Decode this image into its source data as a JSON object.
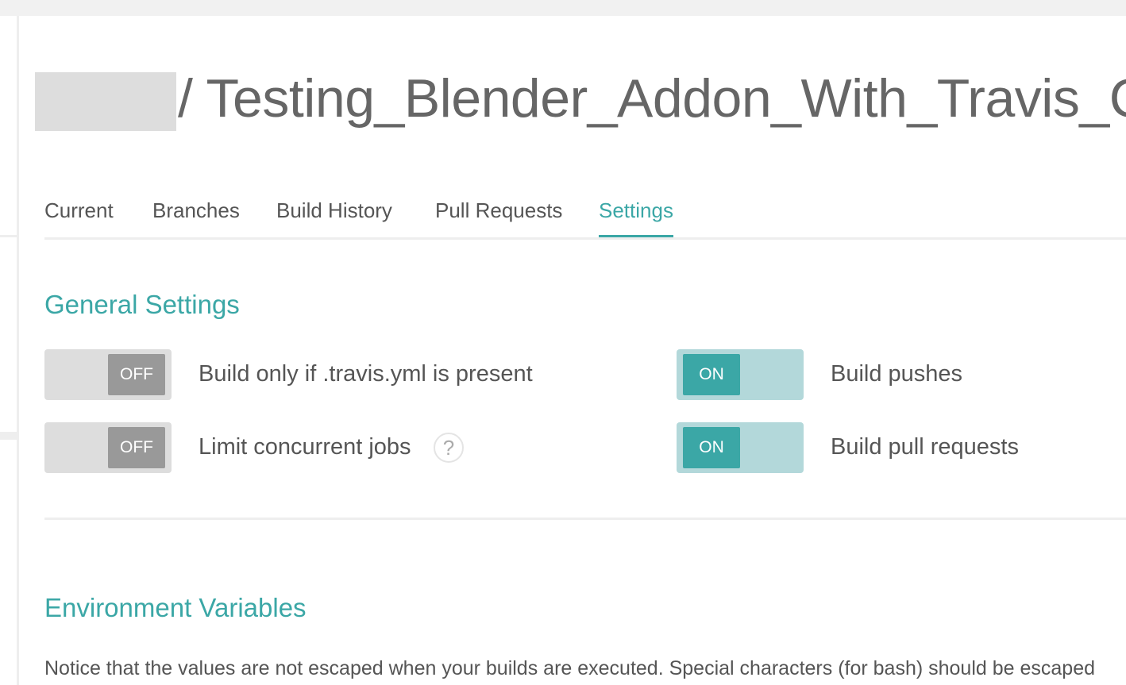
{
  "repo": {
    "separator_and_name": "/ Testing_Blender_Addon_With_Travis_C"
  },
  "tabs": [
    {
      "label": "Current"
    },
    {
      "label": "Branches"
    },
    {
      "label": "Build History"
    },
    {
      "label": "Pull Requests"
    },
    {
      "label": "Settings",
      "active": true
    }
  ],
  "general_settings": {
    "title": "General Settings",
    "settings": [
      {
        "label": "Build only if .travis.yml is present",
        "state": "OFF"
      },
      {
        "label": "Build pushes",
        "state": "ON"
      },
      {
        "label": "Limit concurrent jobs",
        "state": "OFF",
        "help_icon": "?"
      },
      {
        "label": "Build pull requests",
        "state": "ON"
      }
    ]
  },
  "environment_variables": {
    "title": "Environment Variables",
    "notice": "Notice that the values are not escaped when your builds are executed. Special characters (for bash) should be escaped"
  },
  "colors": {
    "accent": "#3ba7a6",
    "toggle_on_track": "#b3d8da",
    "toggle_off_track": "#dddddd",
    "toggle_off_knob": "#999999"
  }
}
